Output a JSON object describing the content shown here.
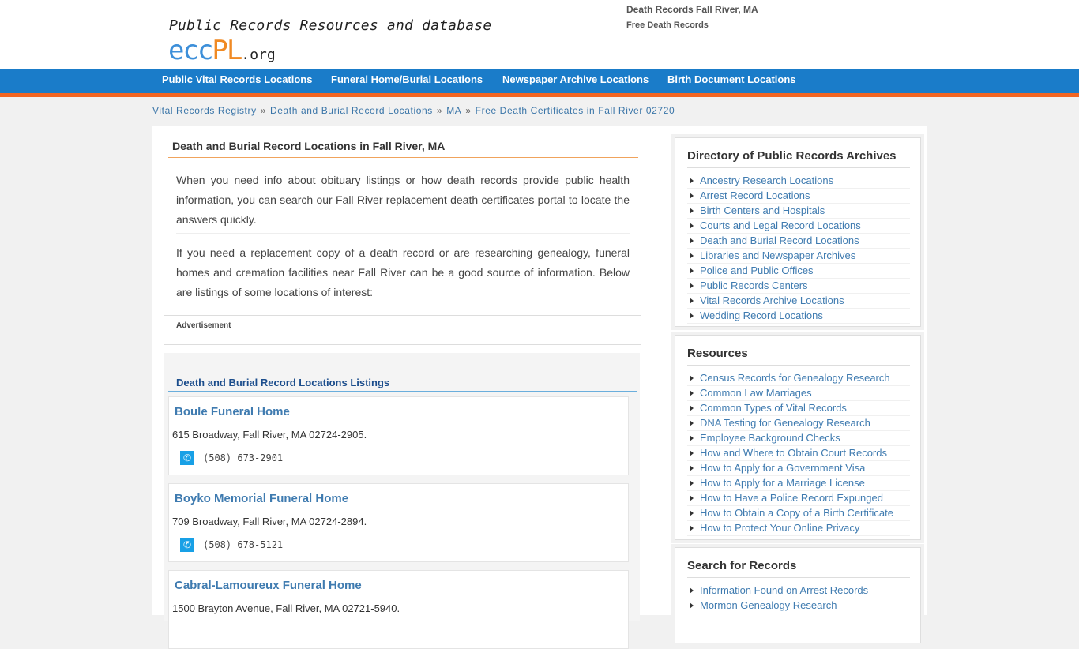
{
  "header": {
    "tagline": "Public Records Resources and database",
    "logo": {
      "part1": "ecc",
      "part2": "PL",
      "part3": ".org"
    },
    "top_title": "Death Records Fall River, MA",
    "top_subtitle": "Free Death Records"
  },
  "nav": {
    "items": [
      "Public Vital Records Locations",
      "Funeral Home/Burial Locations",
      "Newspaper Archive Locations",
      "Birth Document Locations"
    ]
  },
  "breadcrumb": [
    "Vital Records Registry",
    "Death and Burial Record Locations",
    "MA",
    "Free Death Certificates in Fall River 02720"
  ],
  "breadcrumb_separator": "»",
  "main": {
    "title": "Death and Burial Record Locations in Fall River, MA",
    "paragraphs": [
      "When you need info about obituary listings or how death records provide public health information, you can search our Fall River replacement death certificates portal to locate the answers quickly.",
      "If you need a replacement copy of a death record or are researching genealogy, funeral homes and cremation facilities near Fall River can be a good source of information. Below are listings of some locations of interest:"
    ],
    "ad_label": "Advertisement",
    "listings_header": "Death and Burial Record Locations Listings",
    "listings": [
      {
        "name": "Boule Funeral Home",
        "address": "615 Broadway, Fall River, MA 02724-2905.",
        "phone": "(508) 673-2901"
      },
      {
        "name": "Boyko Memorial Funeral Home",
        "address": "709 Broadway, Fall River, MA 02724-2894.",
        "phone": "(508) 678-5121"
      },
      {
        "name": "Cabral-Lamoureux Funeral Home",
        "address": "1500 Brayton Avenue, Fall River, MA 02721-5940.",
        "phone": ""
      }
    ]
  },
  "sidebar": {
    "directory": {
      "title": "Directory of Public Records Archives",
      "items": [
        "Ancestry Research Locations",
        "Arrest Record Locations",
        "Birth Centers and Hospitals",
        "Courts and Legal Record Locations",
        "Death and Burial Record Locations",
        "Libraries and Newspaper Archives",
        "Police and Public Offices",
        "Public Records Centers",
        "Vital Records Archive Locations",
        "Wedding Record Locations"
      ]
    },
    "resources": {
      "title": "Resources",
      "items": [
        "Census Records for Genealogy Research",
        "Common Law Marriages",
        "Common Types of Vital Records",
        "DNA Testing for Genealogy Research",
        "Employee Background Checks",
        "How and Where to Obtain Court Records",
        "How to Apply for a Government Visa",
        "How to Apply for a Marriage License",
        "How to Have a Police Record Expunged",
        "How to Obtain a Copy of a Birth Certificate",
        "How to Protect Your Online Privacy"
      ]
    },
    "search": {
      "title": "Search for Records",
      "items": [
        "Information Found on Arrest Records",
        "Mormon Genealogy Research"
      ]
    }
  },
  "colors": {
    "nav_bg": "#1a7cc9",
    "nav_accent": "#f26522",
    "link": "#3f7bb0",
    "phone_icon": "#18a0e6"
  }
}
